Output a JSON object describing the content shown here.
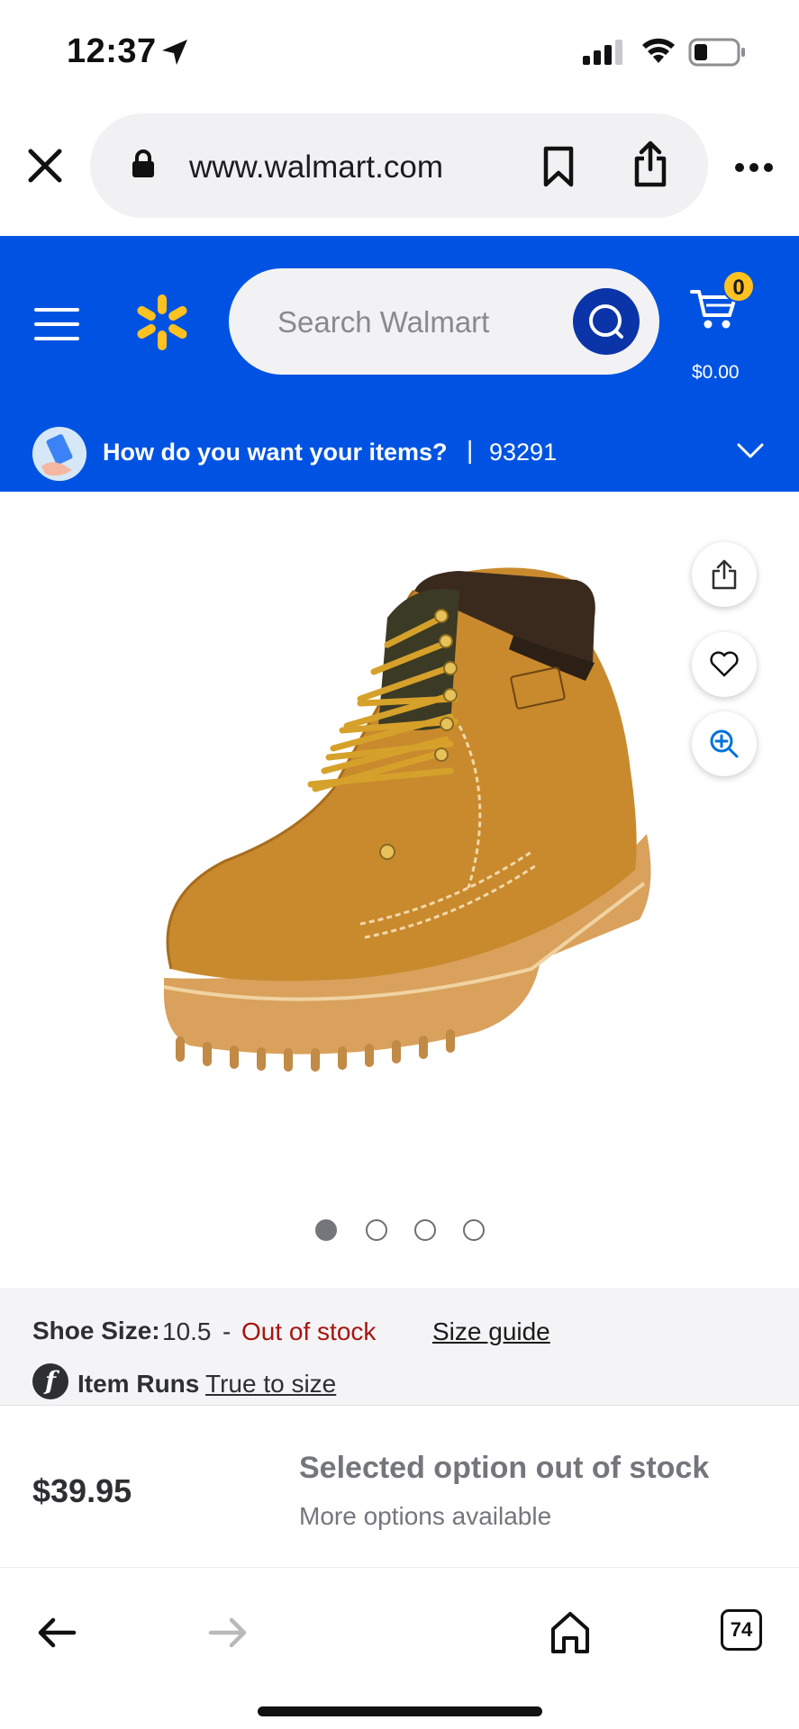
{
  "status_bar": {
    "time": "12:37"
  },
  "browser": {
    "url": "www.walmart.com"
  },
  "header": {
    "search_placeholder": "Search Walmart",
    "cart_count": "0",
    "cart_total": "$0.00",
    "brand_color": "#0053e2",
    "spark_color": "#ffc220"
  },
  "delivery": {
    "question": "How do you want your items?",
    "separator": "|",
    "zip": "93291"
  },
  "gallery": {
    "image_count": 4,
    "active_index": 0
  },
  "product": {
    "size_label": "Shoe Size:",
    "size_value": "10.5",
    "size_dash": "-",
    "stock_status": "Out of stock",
    "size_guide": "Size guide",
    "fit_icon": "f",
    "runs_label": "Item Runs",
    "runs_value": "True to size",
    "price": "$39.95",
    "oos_title": "Selected option out of stock",
    "oos_subtitle": "More options available"
  },
  "bottom_nav": {
    "tab_count": "74"
  }
}
